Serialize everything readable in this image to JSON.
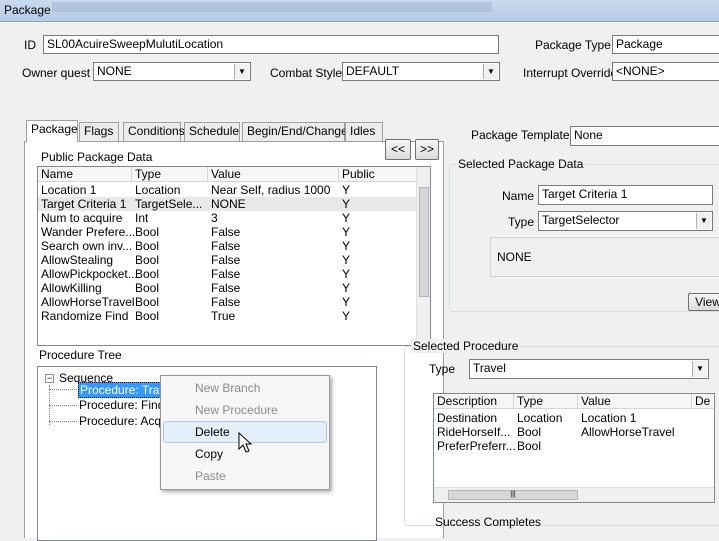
{
  "window": {
    "title": "Package"
  },
  "top": {
    "id_label": "ID",
    "id_value": "SL00AcuireSweepMulutiLocation",
    "package_type_label": "Package Type",
    "package_type_value": "Package",
    "owner_quest_label": "Owner quest",
    "owner_quest_value": "NONE",
    "combat_style_label": "Combat Style",
    "combat_style_value": "DEFAULT",
    "interrupt_override_label": "Interrupt Override",
    "interrupt_override_value": "<NONE>"
  },
  "tabs": [
    "Package",
    "Flags",
    "Conditions",
    "Schedule",
    "Begin/End/Change",
    "Idles"
  ],
  "public_data": {
    "title": "Public Package Data",
    "prev_label": "<<",
    "next_label": ">>",
    "columns": [
      "Name",
      "Type",
      "Value",
      "Public"
    ],
    "rows": [
      [
        "Location 1",
        "Location",
        "Near Self, radius 1000",
        "Y"
      ],
      [
        "Target Criteria 1",
        "TargetSele...",
        "NONE",
        "Y"
      ],
      [
        "Num to acquire",
        "Int",
        "3",
        "Y"
      ],
      [
        "Wander Prefere...",
        "Bool",
        "False",
        "Y"
      ],
      [
        "Search own inv...",
        "Bool",
        "False",
        "Y"
      ],
      [
        "AllowStealing",
        "Bool",
        "False",
        "Y"
      ],
      [
        "AllowPickpocket...",
        "Bool",
        "False",
        "Y"
      ],
      [
        "AllowKilling",
        "Bool",
        "False",
        "Y"
      ],
      [
        "AllowHorseTravel",
        "Bool",
        "False",
        "Y"
      ],
      [
        "Randomize Find",
        "Bool",
        "True",
        "Y"
      ]
    ]
  },
  "template": {
    "label": "Package Template",
    "value": "None"
  },
  "selected_data": {
    "title": "Selected Package Data",
    "name_label": "Name",
    "name_value": "Target Criteria 1",
    "type_label": "Type",
    "type_value": "TargetSelector",
    "value_text": "NONE",
    "view_label": "View"
  },
  "procedure_tree": {
    "title": "Procedure Tree",
    "root": "Sequence",
    "items": [
      "Procedure: Travel",
      "Procedure: Find",
      "Procedure: Acqu"
    ]
  },
  "context_menu": {
    "items": [
      "New Branch",
      "New Procedure",
      "Delete",
      "Copy",
      "Paste"
    ]
  },
  "selected_procedure": {
    "title": "Selected Procedure",
    "type_label": "Type",
    "type_value": "Travel",
    "columns": [
      "Description",
      "Type",
      "Value",
      "De"
    ],
    "rows": [
      [
        "Destination",
        "Location",
        "Location 1"
      ],
      [
        "RideHorseIf...",
        "Bool",
        "AllowHorseTravel"
      ],
      [
        "PreferPreferr...",
        "Bool",
        ""
      ]
    ],
    "success_label": "Success Completes"
  }
}
